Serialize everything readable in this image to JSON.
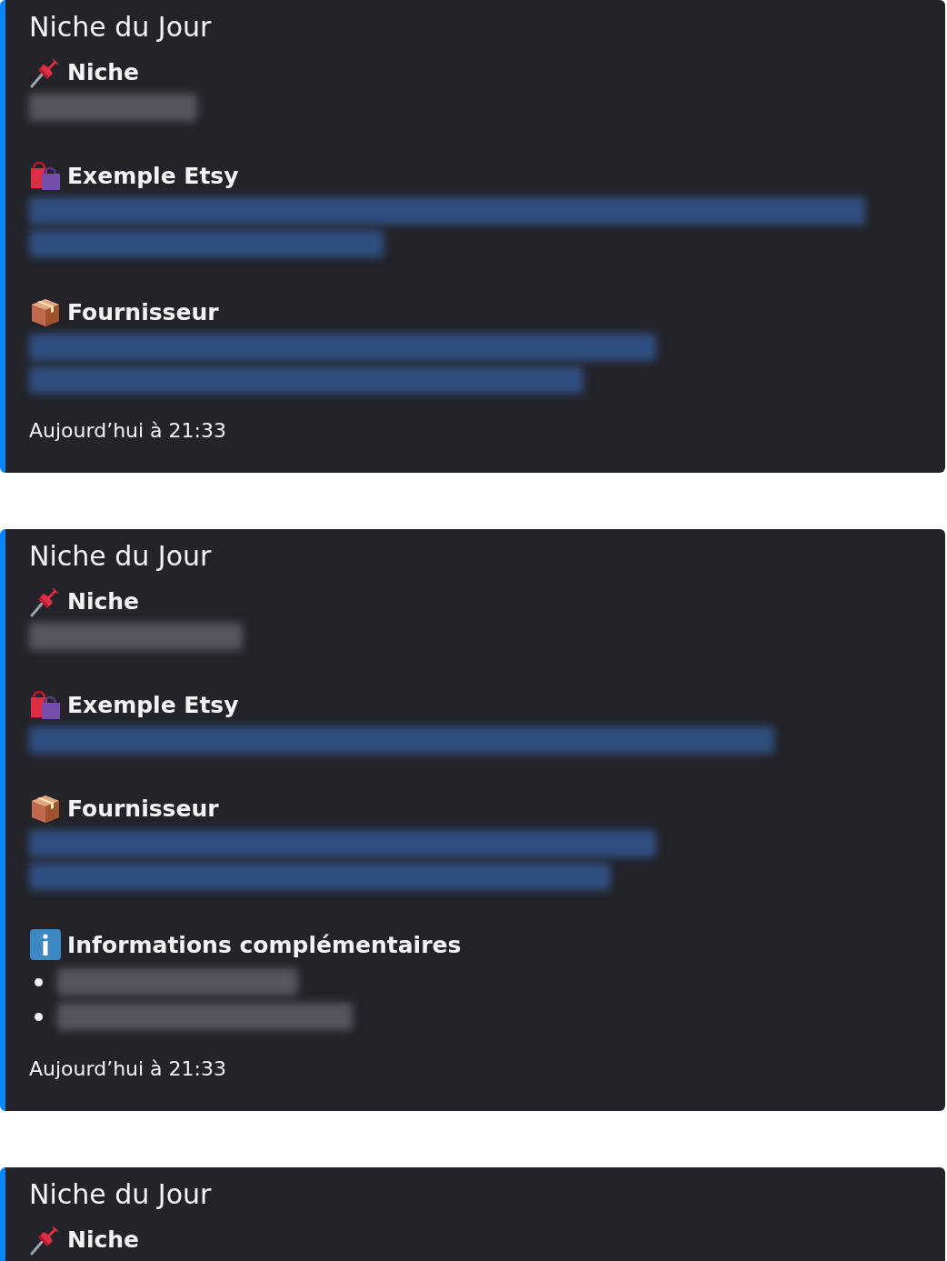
{
  "cards": [
    {
      "title": "Niche du Jour",
      "fields": [
        {
          "kind": "pin",
          "name": "Niche",
          "lines": [
            {
              "kind": "text"
            }
          ]
        },
        {
          "kind": "bags",
          "name": "Exemple Etsy",
          "lines": [
            {
              "kind": "link"
            },
            {
              "kind": "link"
            }
          ]
        },
        {
          "kind": "package",
          "name": "Fournisseur",
          "lines": [
            {
              "kind": "link"
            },
            {
              "kind": "link"
            }
          ]
        }
      ],
      "timestamp": "Aujourd’hui à 21:33"
    },
    {
      "title": "Niche du Jour",
      "fields": [
        {
          "kind": "pin",
          "name": "Niche",
          "lines": [
            {
              "kind": "text"
            }
          ]
        },
        {
          "kind": "bags",
          "name": "Exemple Etsy",
          "lines": [
            {
              "kind": "link"
            }
          ]
        },
        {
          "kind": "package",
          "name": "Fournisseur",
          "lines": [
            {
              "kind": "link"
            },
            {
              "kind": "link"
            }
          ]
        },
        {
          "kind": "info",
          "name": "Informations complémentaires",
          "lines": [
            {
              "kind": "bullet"
            },
            {
              "kind": "bullet"
            }
          ]
        }
      ],
      "timestamp": "Aujourd’hui à 21:33"
    },
    {
      "title": "Niche du Jour",
      "fields": [
        {
          "kind": "pin",
          "name": "Niche"
        }
      ]
    }
  ]
}
